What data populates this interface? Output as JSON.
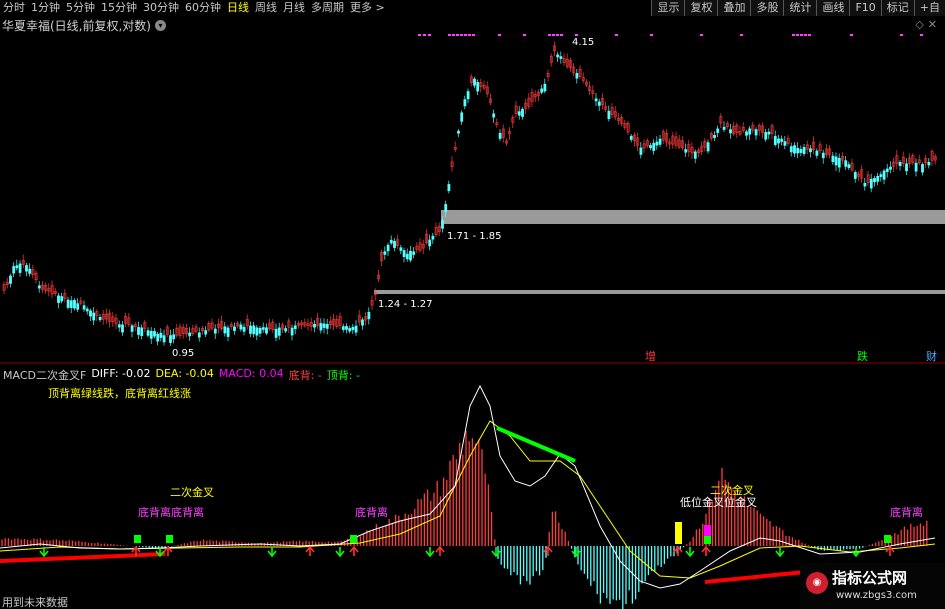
{
  "topbar": {
    "periods": [
      "分时",
      "1分钟",
      "5分钟",
      "15分钟",
      "30分钟",
      "60分钟",
      "日线",
      "周线",
      "月线",
      "多周期",
      "更多 >"
    ],
    "active_period": "日线",
    "tools": [
      "显示",
      "复权",
      "叠加",
      "多股",
      "统计",
      "画线",
      "F10",
      "标记",
      "+自"
    ]
  },
  "chart_header": {
    "title": "华夏幸福(日线,前复权,对数)"
  },
  "price_chart": {
    "annotations": {
      "high_label": "4.15",
      "low_label": "0.95",
      "zone_upper": "1.71 - 1.85",
      "zone_lower": "1.24 - 1.27",
      "tag_zeng": "增",
      "tag_die": "跌",
      "tag_cai": "财"
    }
  },
  "macd_panel": {
    "name": "MACD二次金叉F",
    "diff_label": "DIFF: -0.02",
    "dea_label": "DEA: -0.04",
    "macd_label": "MACD: 0.04",
    "dibei_label": "底背: -",
    "dingbei_label": "顶背: -",
    "note": "顶背离绿线跌，底背离红线涨",
    "label_second_cross_1": "二次金叉",
    "label_dibeili_1": "底背离底背离",
    "label_dibeili_2": "底背离",
    "label_low_cross": "低位金叉位金叉",
    "label_second_cross_2": "二次金叉",
    "label_dibeili_3": "底背离"
  },
  "footer": {
    "bottom_left": "用到未来数据"
  },
  "watermark": {
    "title": "指标公式网",
    "url": "www.zbgs3.com"
  },
  "colors": {
    "up": "#ff3c3c",
    "down": "#54ffff",
    "diff": "#ffffff",
    "dea": "#ffff00",
    "macd_label": "#ff00ff",
    "dibei": "#ff3c3c",
    "dingbei": "#00ff00",
    "zone": "#9a9a9a",
    "divergence_green": "#00ff00",
    "divergence_red": "#ff0000"
  }
}
